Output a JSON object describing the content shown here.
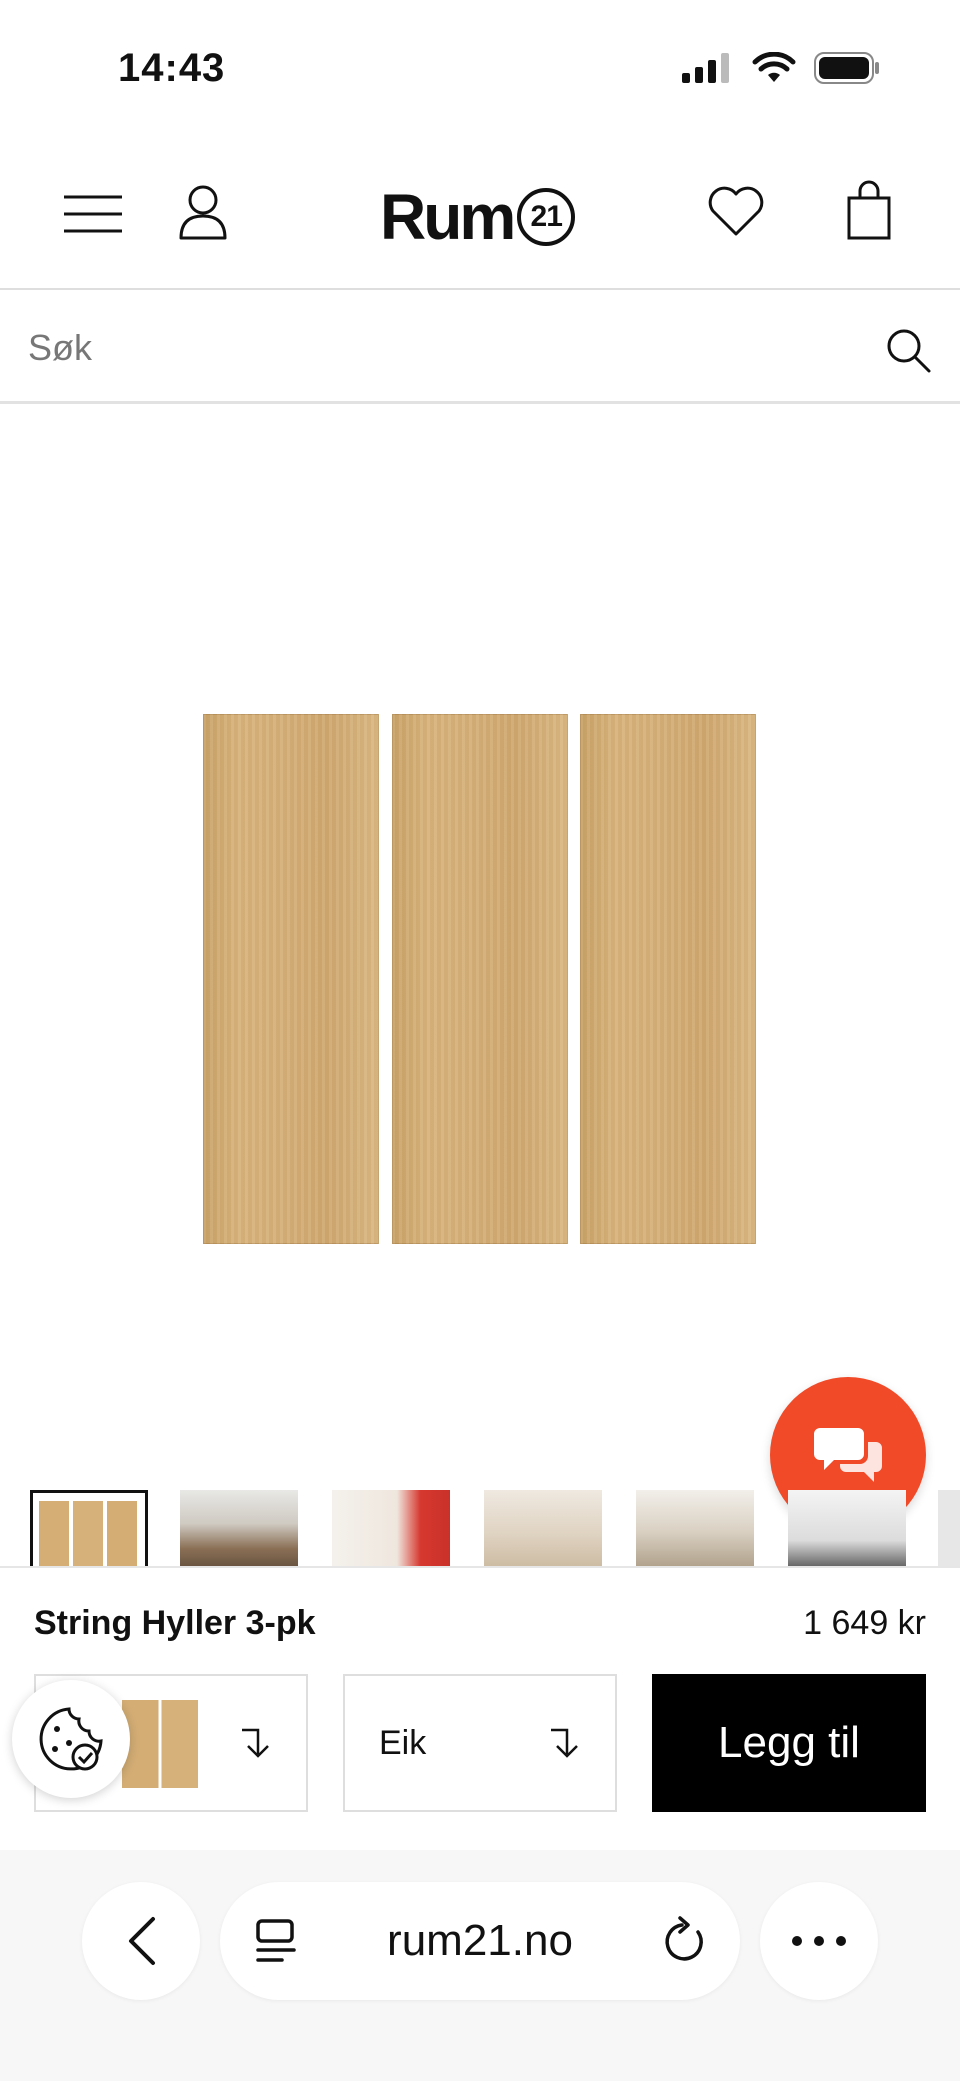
{
  "status_bar": {
    "time": "14:43"
  },
  "header": {
    "logo_text": "Rum",
    "logo_number": "21"
  },
  "search": {
    "placeholder": "Søk",
    "value": ""
  },
  "product": {
    "name": "String Hyller 3-pk",
    "price": "1 649 kr",
    "variant_value": "",
    "color_value": "Eik",
    "add_label": "Legg til"
  },
  "thumbnails_count": 6,
  "browser": {
    "url": "rum21.no"
  },
  "colors": {
    "accent_chat": "#f04a28",
    "button": "#000000",
    "wood": "#d6b27a"
  },
  "icons": [
    "menu-icon",
    "account-icon",
    "heart-icon",
    "bag-icon",
    "search-icon",
    "chat-icon",
    "cookie-icon",
    "chevron-down-icon",
    "back-icon",
    "tabs-icon",
    "reload-icon",
    "more-icon"
  ]
}
